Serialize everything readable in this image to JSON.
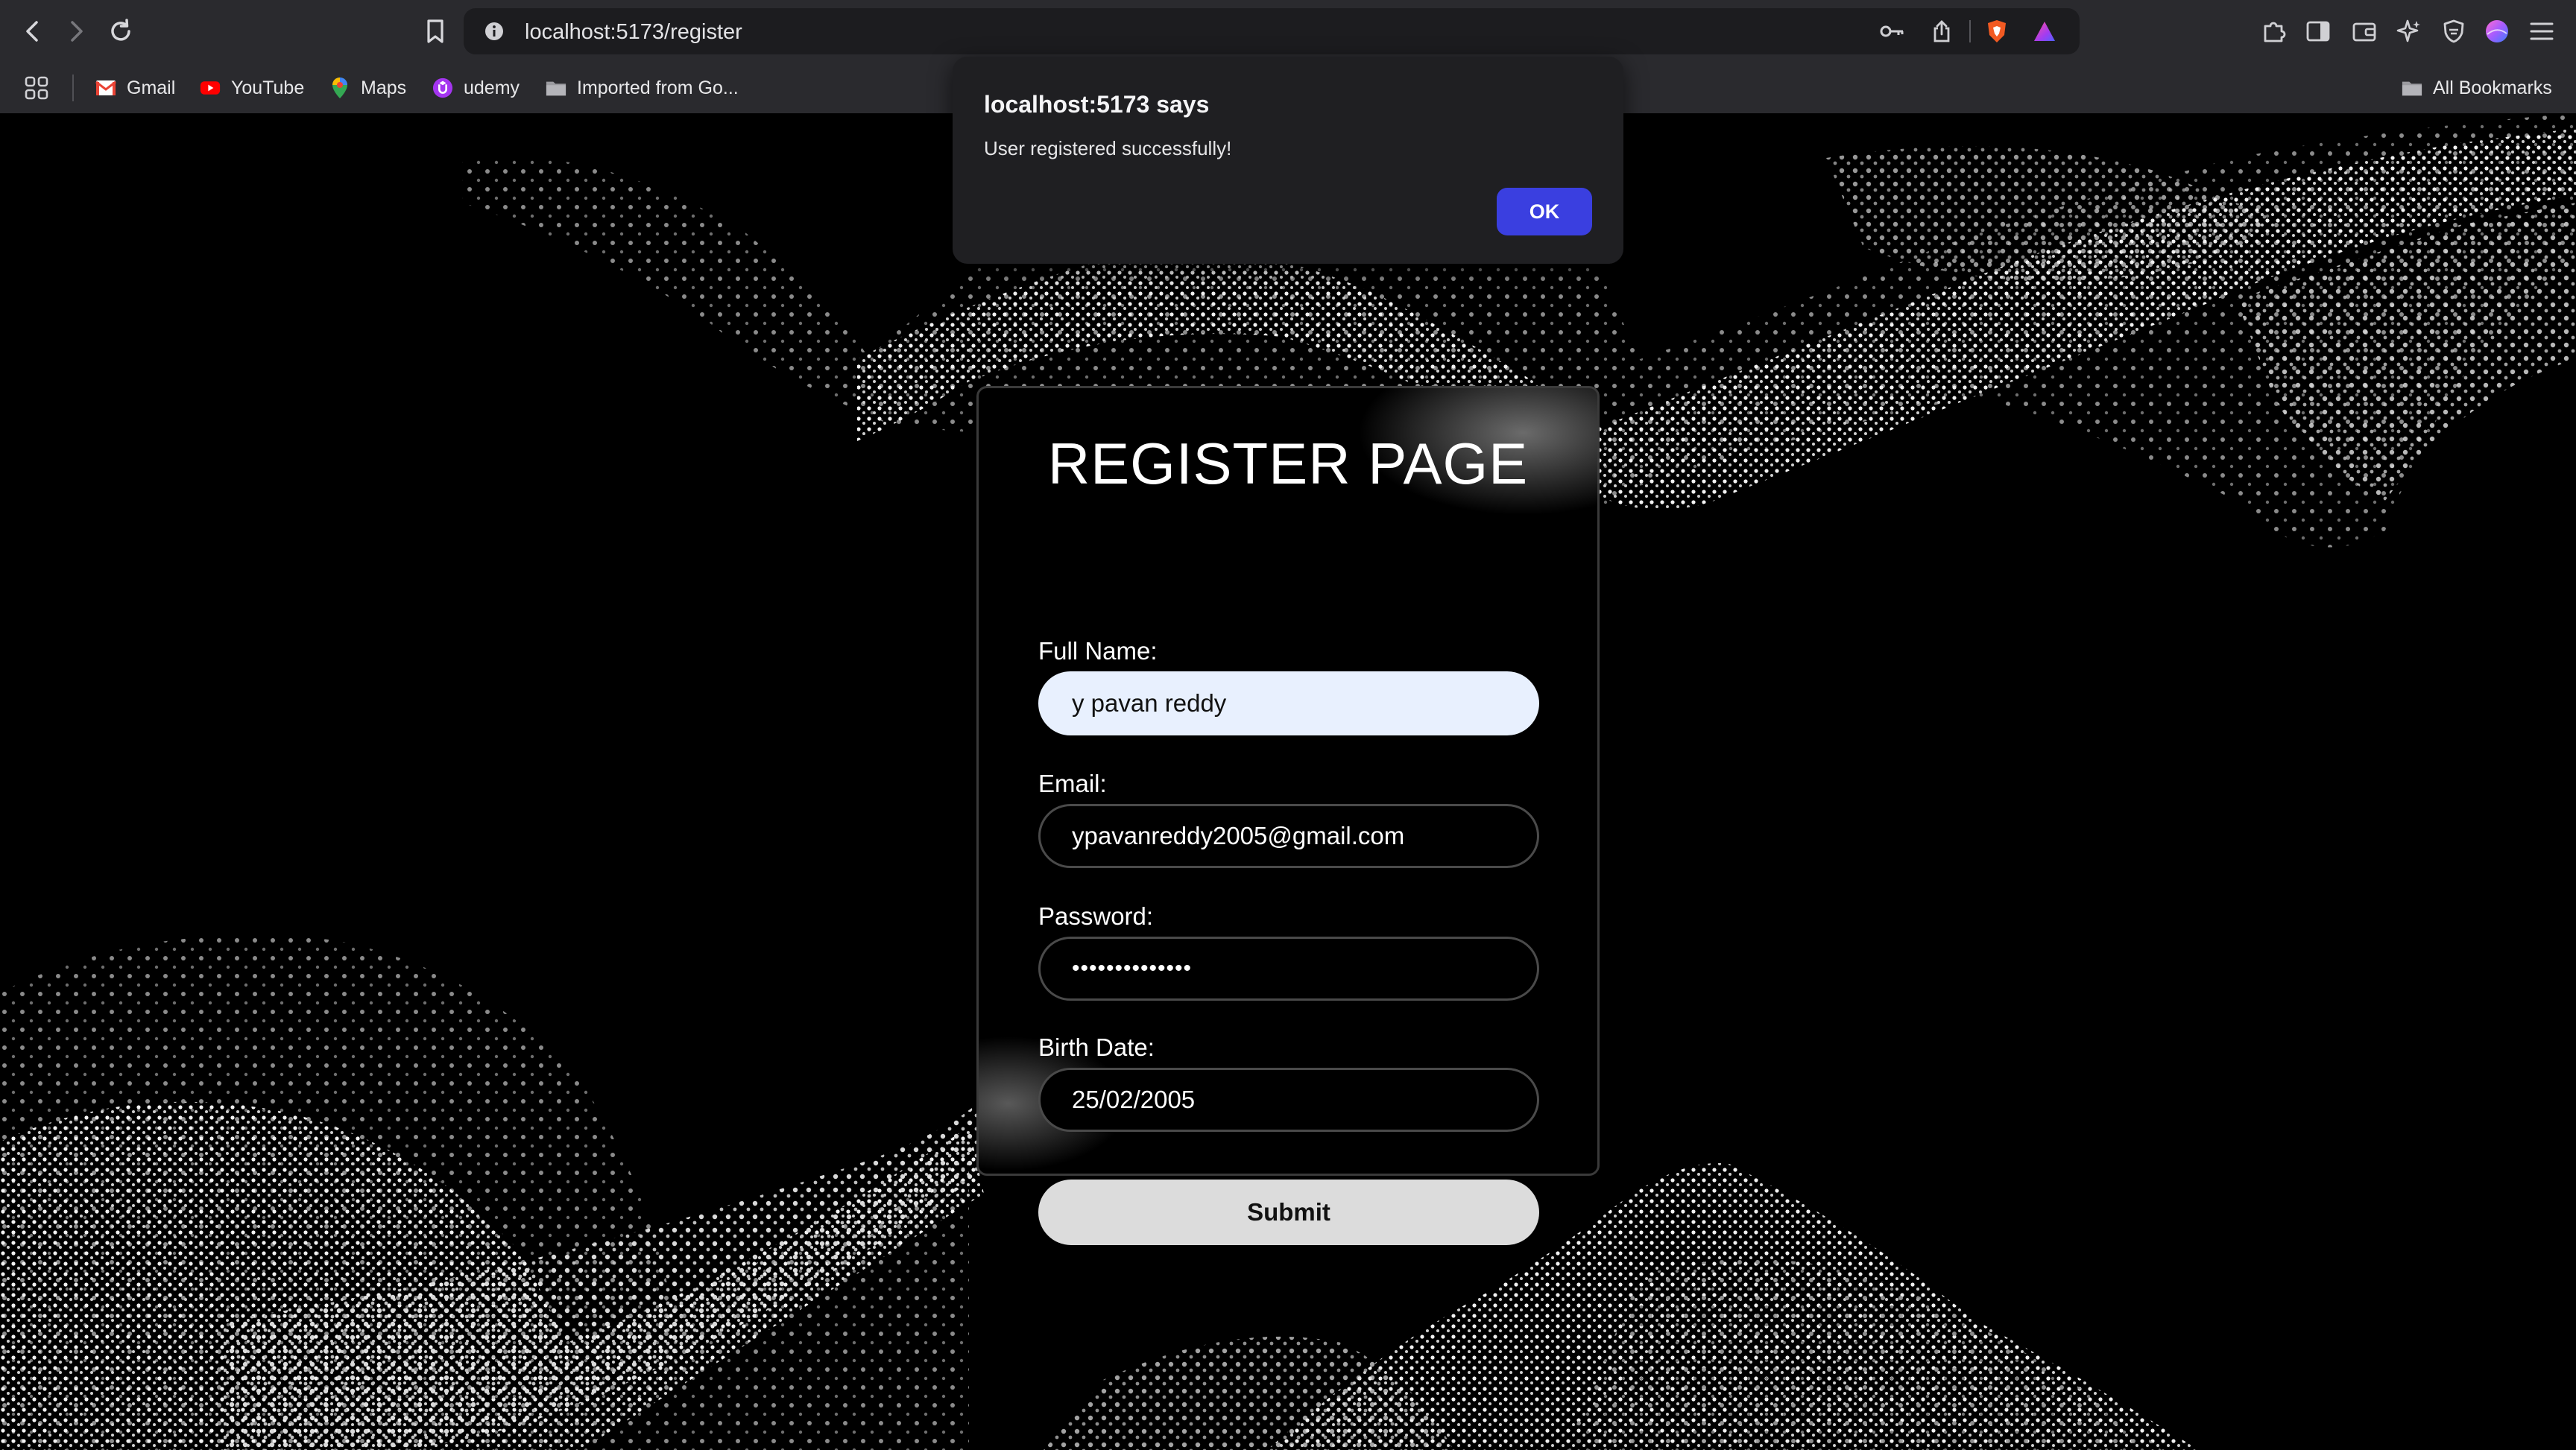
{
  "browser": {
    "url": "localhost:5173/register",
    "bookmarks": [
      {
        "label": "Gmail",
        "icon": "gmail-icon"
      },
      {
        "label": "YouTube",
        "icon": "youtube-icon"
      },
      {
        "label": "Maps",
        "icon": "maps-icon"
      },
      {
        "label": "udemy",
        "icon": "udemy-icon"
      },
      {
        "label": "Imported from Go...",
        "icon": "folder-icon"
      }
    ],
    "all_bookmarks": "All Bookmarks"
  },
  "dialog": {
    "title": "localhost:5173 says",
    "message": "User registered successfully!",
    "ok_label": "OK"
  },
  "form": {
    "title": "REGISTER PAGE",
    "full_name_label": "Full Name:",
    "full_name_value": "y pavan reddy",
    "email_label": "Email:",
    "email_value": "ypavanreddy2005@gmail.com",
    "password_label": "Password:",
    "password_value": "••••••••••••••",
    "birth_date_label": "Birth Date:",
    "birth_date_value": "25/02/2005",
    "submit_label": "Submit"
  },
  "colors": {
    "page_bg": "#000000",
    "autofill_bg": "#e8f0fe",
    "ok_button": "#3a3fe0",
    "submit_bg": "#dcdcdc"
  }
}
